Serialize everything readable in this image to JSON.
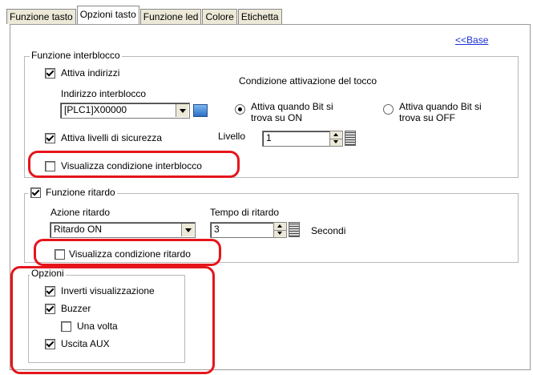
{
  "tabs": [
    "Funzione tasto",
    "Opzioni tasto",
    "Funzione led",
    "Colore",
    "Etichetta"
  ],
  "active_tab_index": 1,
  "base_link": "<<Base",
  "interlock": {
    "legend": "Funzione interblocco",
    "enable_address_label": "Attiva indirizzi",
    "enable_address_checked": true,
    "address_label": "Indirizzo interblocco",
    "address_value": "[PLC1]X00000",
    "touch_condition_label": "Condizione attivazione del tocco",
    "radio_on_label_1": "Attiva quando Bit si",
    "radio_on_label_2": "trova su ON",
    "radio_on_selected": true,
    "radio_off_label_1": "Attiva quando Bit si",
    "radio_off_label_2": "trova su OFF",
    "security_label": "Attiva livelli di sicurezza",
    "security_checked": true,
    "level_label": "Livello",
    "level_value": "1",
    "show_condition_label": "Visualizza condizione interblocco",
    "show_condition_checked": false
  },
  "delay": {
    "legend": "Funzione ritardo",
    "legend_checked": true,
    "action_label": "Azione ritardo",
    "action_value": "Ritardo ON",
    "time_label": "Tempo di ritardo",
    "time_value": "3",
    "unit": "Secondi",
    "show_condition_label": "Visualizza condizione ritardo",
    "show_condition_checked": false
  },
  "options": {
    "legend": "Opzioni",
    "invert_label": "Inverti visualizzazione",
    "invert_checked": true,
    "buzzer_label": "Buzzer",
    "buzzer_checked": true,
    "once_label": "Una volta",
    "once_checked": false,
    "aux_label": "Uscita AUX",
    "aux_checked": true
  },
  "highlight_color": "#e5151c",
  "link_color": "#1a2fd6"
}
